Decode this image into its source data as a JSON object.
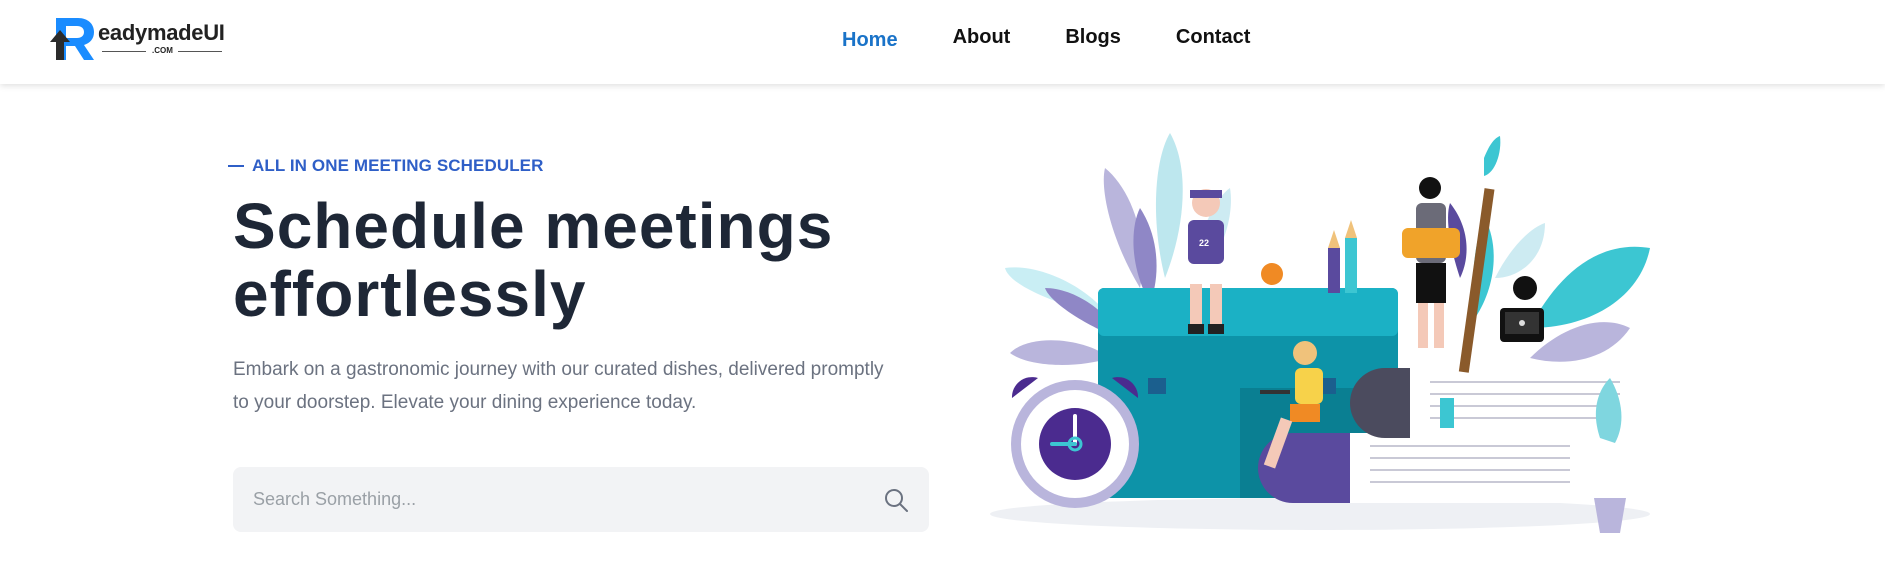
{
  "brand": {
    "logo_text": "eadymadeUI",
    "logo_subtext": ".COM"
  },
  "nav": {
    "items": [
      {
        "label": "Home",
        "active": true
      },
      {
        "label": "About",
        "active": false
      },
      {
        "label": "Blogs",
        "active": false
      },
      {
        "label": "Contact",
        "active": false
      }
    ]
  },
  "hero": {
    "eyebrow": "ALL IN ONE MEETING SCHEDULER",
    "title_line1": "Schedule meetings",
    "title_line2": "effortlessly",
    "description_line1": "Embark on a gastronomic journey with our curated dishes, delivered promptly",
    "description_line2": "to your doorstep. Elevate your dining experience today."
  },
  "search": {
    "placeholder": "Search Something...",
    "value": "",
    "icon": "search-icon"
  },
  "illustration": {
    "jersey_number": "22"
  },
  "colors": {
    "accent": "#1a73c8",
    "eyebrow": "#2f5fc7",
    "title": "#1e2736",
    "body_text": "#6b7280",
    "search_bg": "#f2f3f5"
  }
}
